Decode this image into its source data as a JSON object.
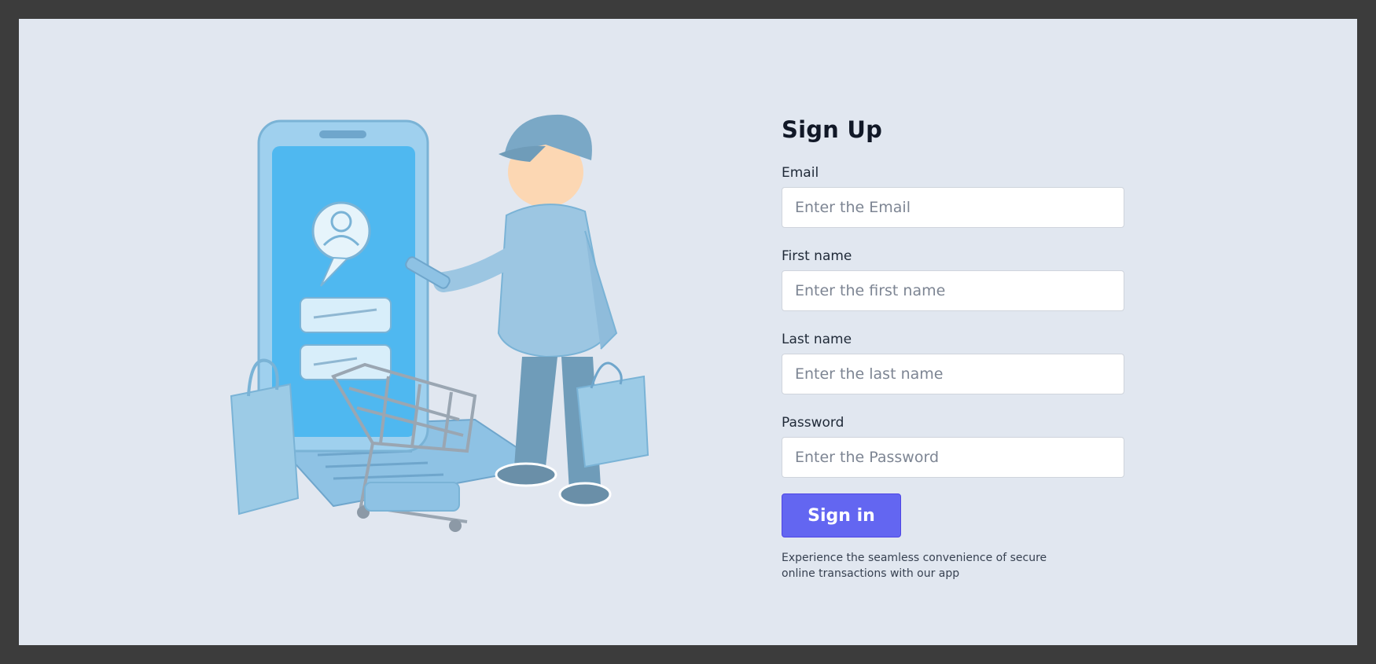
{
  "illustration": {
    "icon": "online-shopping-illustration",
    "colors": {
      "primary": "#8fc3e6",
      "screen": "#4fb8f0",
      "dark": "#5f94b8"
    }
  },
  "form": {
    "title": "Sign Up",
    "fields": [
      {
        "label": "Email",
        "placeholder": "Enter the Email",
        "value": ""
      },
      {
        "label": "First name",
        "placeholder": "Enter the first name",
        "value": ""
      },
      {
        "label": "Last name",
        "placeholder": "Enter the last name",
        "value": ""
      },
      {
        "label": "Password",
        "placeholder": "Enter the Password",
        "value": ""
      }
    ],
    "submit_label": "Sign in",
    "footnote": "Experience the seamless convenience of secure online transactions with our app",
    "accent_color": "#6366f1"
  }
}
